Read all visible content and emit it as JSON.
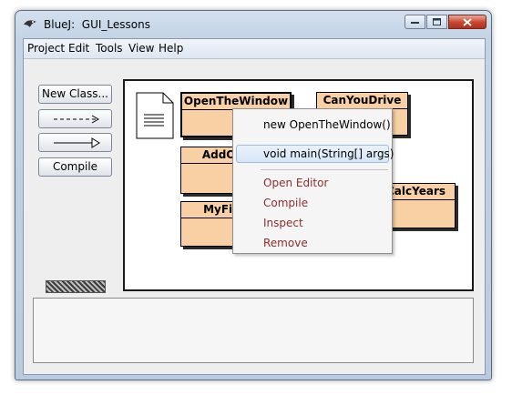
{
  "window": {
    "app_name": "BlueJ:",
    "project_name": "GUI_Lessons"
  },
  "menubar": {
    "items": [
      "Project",
      "Edit",
      "Tools",
      "View",
      "Help"
    ]
  },
  "toolbar": {
    "new_class": "New Class...",
    "compile": "Compile"
  },
  "classes": [
    "OpenTheWindow",
    "CanYouDrive",
    "AddOne",
    "MyFirst",
    "CalcYears"
  ],
  "context_menu": {
    "items": [
      "new OpenTheWindow()",
      "void main(String[] args)",
      "Open Editor",
      "Compile",
      "Inspect",
      "Remove"
    ]
  },
  "colors": {
    "class_fill": "#f8d0a3",
    "menu_red": "#8e2d2d",
    "highlight": "#d6e6f7"
  }
}
